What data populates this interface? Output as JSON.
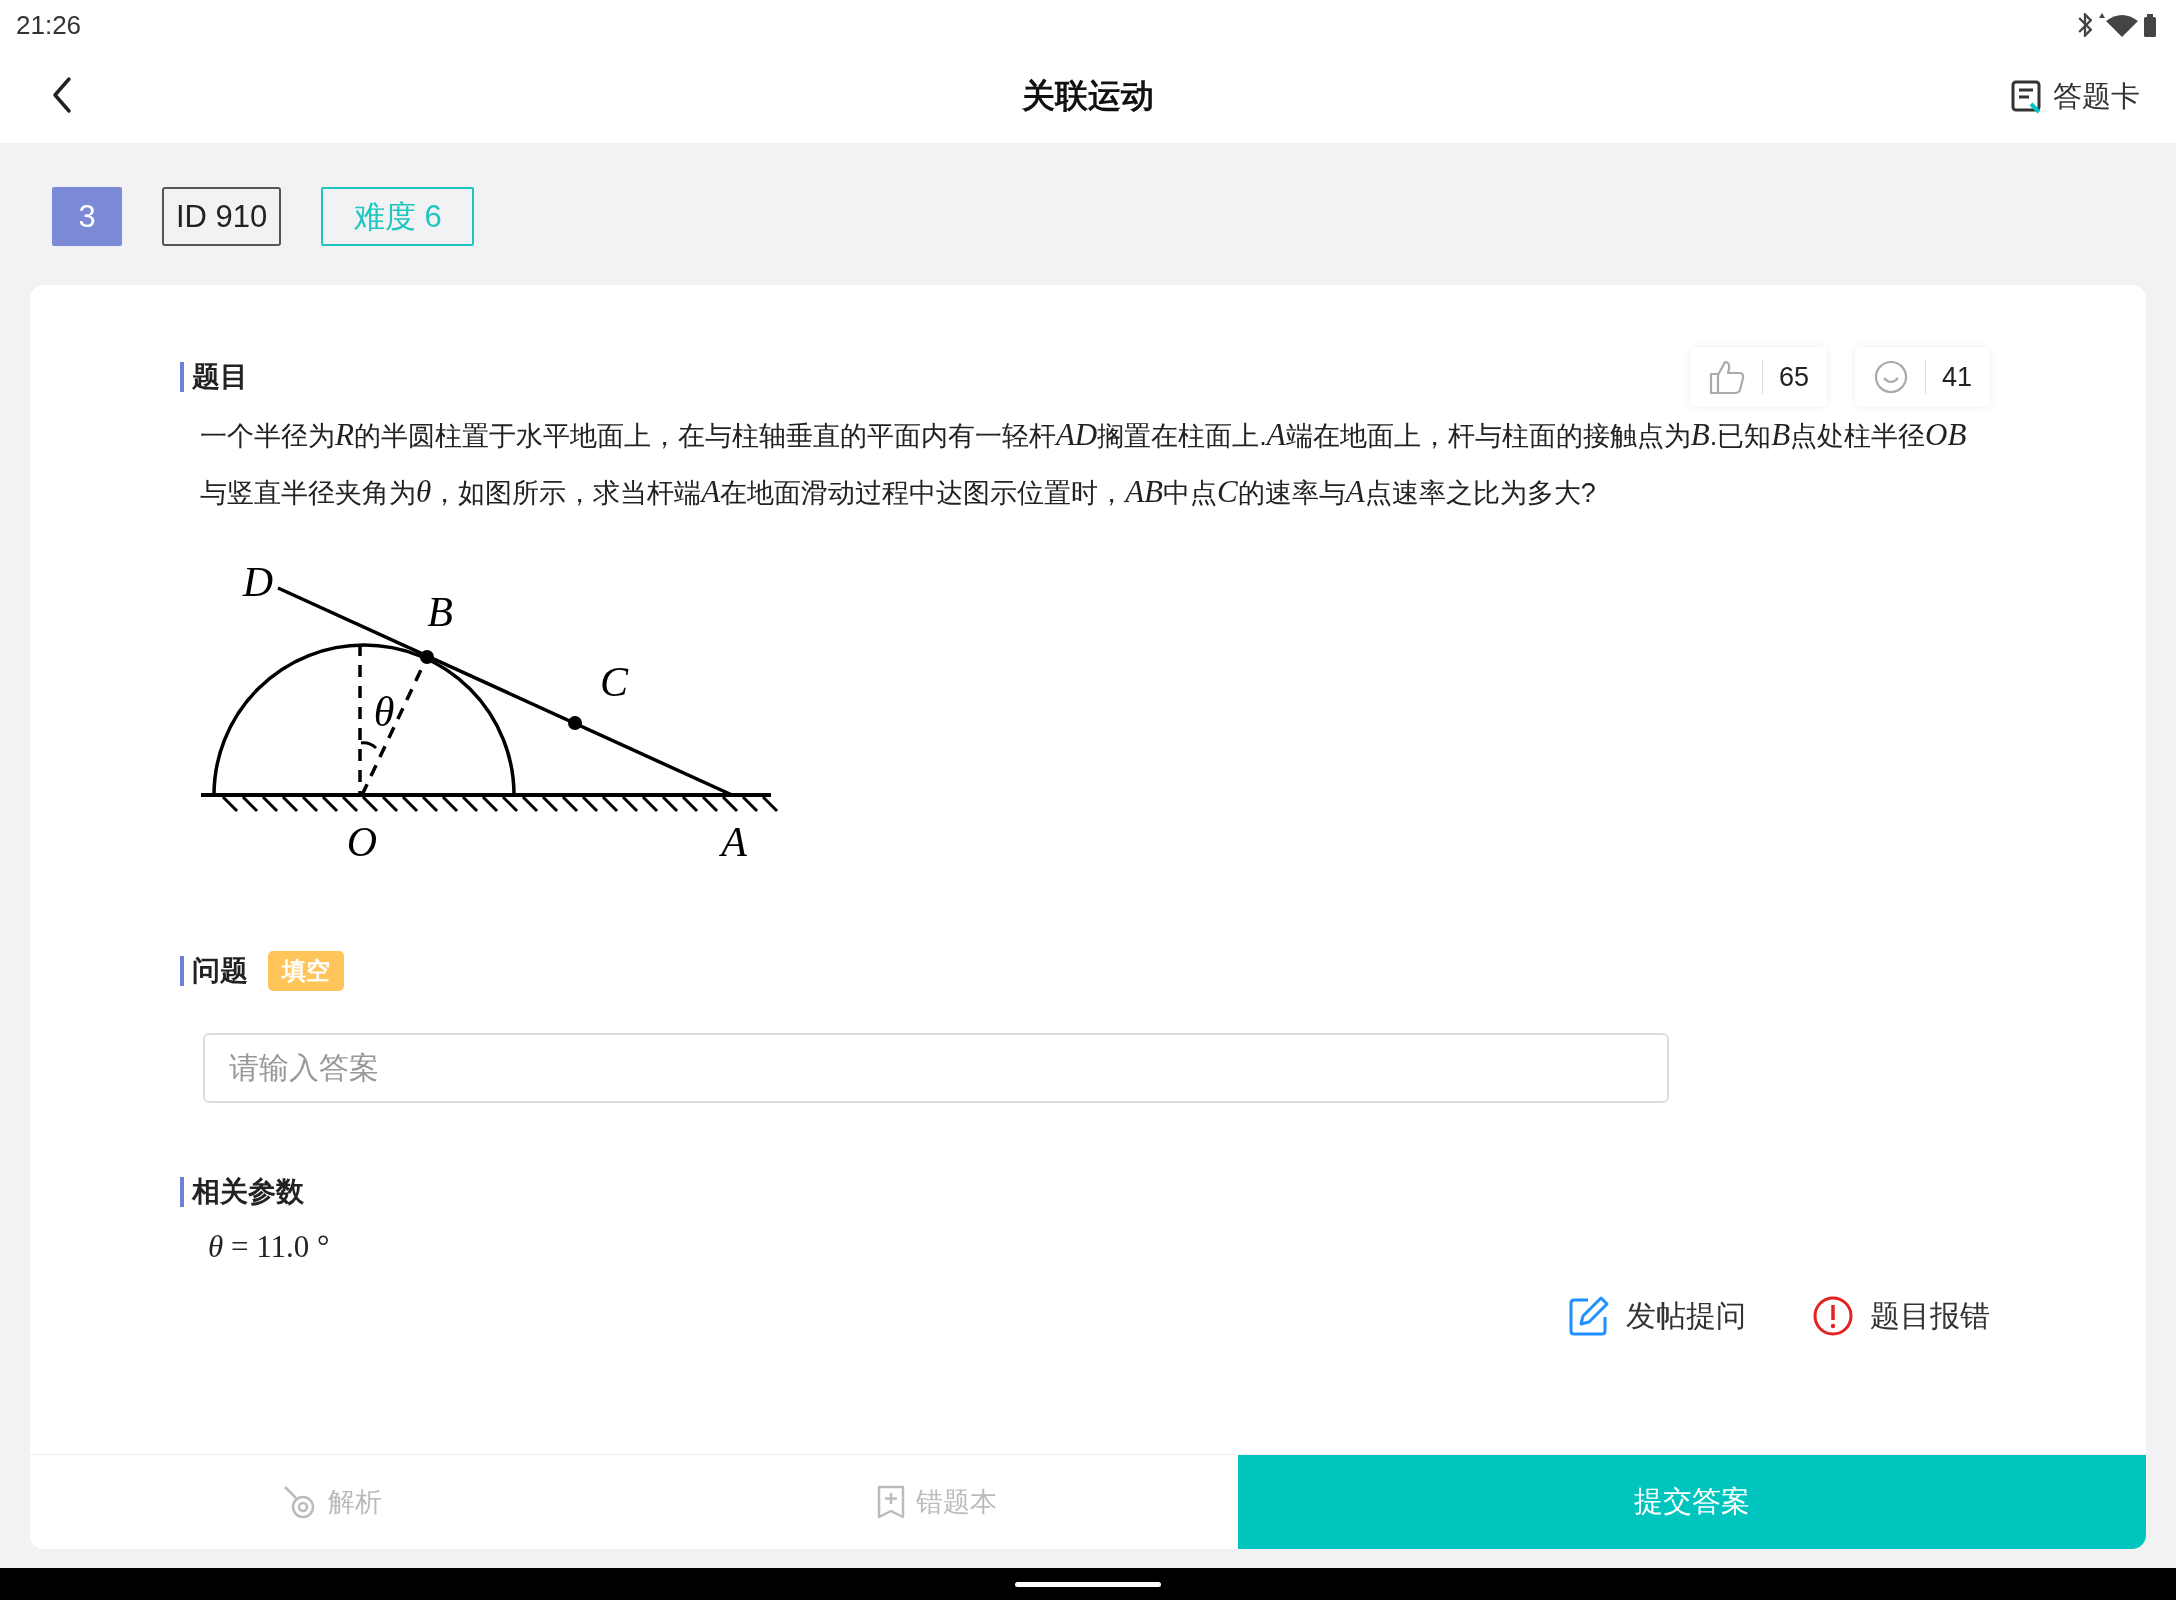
{
  "status_bar": {
    "time": "21:26"
  },
  "header": {
    "title": "关联运动",
    "answer_card": "答题卡"
  },
  "tags": {
    "number": "3",
    "id": "ID 910",
    "difficulty": "难度 6"
  },
  "question": {
    "heading": "题目",
    "likes": "65",
    "reactions": "41",
    "text": [
      {
        "kind": "plain",
        "text": "一个半径为"
      },
      {
        "kind": "math",
        "text": "R"
      },
      {
        "kind": "plain",
        "text": "的半圆柱置于水平地面上，在与柱轴垂直的平面内有一轻杆"
      },
      {
        "kind": "math",
        "text": "AD"
      },
      {
        "kind": "plain",
        "text": "搁置在柱面上."
      },
      {
        "kind": "math",
        "text": "A"
      },
      {
        "kind": "plain",
        "text": "端在地面上，杆与柱面的接触点为"
      },
      {
        "kind": "math",
        "text": "B"
      },
      {
        "kind": "plain",
        "text": ".已知"
      },
      {
        "kind": "math",
        "text": "B"
      },
      {
        "kind": "plain",
        "text": "点处柱半径"
      },
      {
        "kind": "math",
        "text": "OB"
      },
      {
        "kind": "plain",
        "text": "与竖直半径夹角为"
      },
      {
        "kind": "math",
        "text": "θ"
      },
      {
        "kind": "plain",
        "text": "，如图所示，求当杆端"
      },
      {
        "kind": "math",
        "text": "A"
      },
      {
        "kind": "plain",
        "text": "在地面滑动过程中达图示位置时，"
      },
      {
        "kind": "math",
        "text": "AB"
      },
      {
        "kind": "plain",
        "text": "中点"
      },
      {
        "kind": "math",
        "text": "C"
      },
      {
        "kind": "plain",
        "text": "的速率与"
      },
      {
        "kind": "math",
        "text": "A"
      },
      {
        "kind": "plain",
        "text": "点速率之比为多大?"
      }
    ],
    "diagram_labels": [
      "D",
      "B",
      "C",
      "θ",
      "O",
      "A"
    ]
  },
  "problem": {
    "heading": "问题",
    "badge": "填空",
    "placeholder": "请输入答案"
  },
  "parameters": {
    "heading": "相关参数",
    "items": [
      {
        "symbol": "θ",
        "value": "= 11.0 °"
      }
    ]
  },
  "actions": [
    {
      "kind": "post",
      "label": "发帖提问"
    },
    {
      "kind": "report",
      "label": "题目报错"
    }
  ],
  "bottom_bar": {
    "tabs": [
      {
        "kind": "analysis",
        "label": "解析"
      },
      {
        "kind": "notebook",
        "label": "错题本"
      }
    ],
    "submit": "提交答案"
  }
}
